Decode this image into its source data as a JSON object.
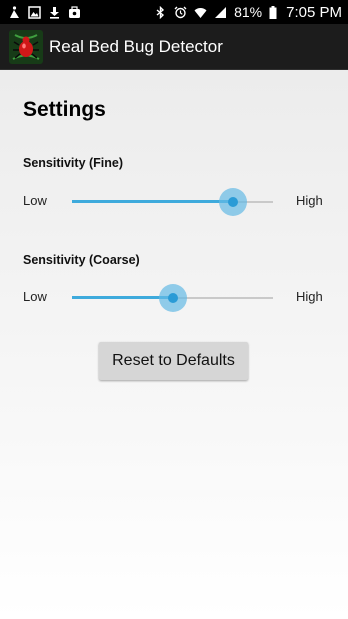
{
  "status_bar": {
    "battery_percent": "81%",
    "time": "7:05 PM",
    "left_icons": [
      "hiker-notification-icon",
      "image-notification-icon",
      "download-icon",
      "work-notification-icon"
    ],
    "right_icons": [
      "bluetooth-icon",
      "alarm-icon",
      "wifi-icon",
      "cell-signal-icon",
      "battery-icon"
    ]
  },
  "app_bar": {
    "title": "Real Bed Bug Detector",
    "icon": "bed-bug-app-icon"
  },
  "settings": {
    "title": "Settings",
    "fine": {
      "label": "Sensitivity (Fine)",
      "low_label": "Low",
      "high_label": "High",
      "value": 0.8
    },
    "coarse": {
      "label": "Sensitivity (Coarse)",
      "low_label": "Low",
      "high_label": "High",
      "value": 0.5
    },
    "reset_label": "Reset to Defaults"
  },
  "colors": {
    "accent": "#3eaadc",
    "thumb": "#2a9bd6",
    "app_bar": "#1c1c1c"
  }
}
